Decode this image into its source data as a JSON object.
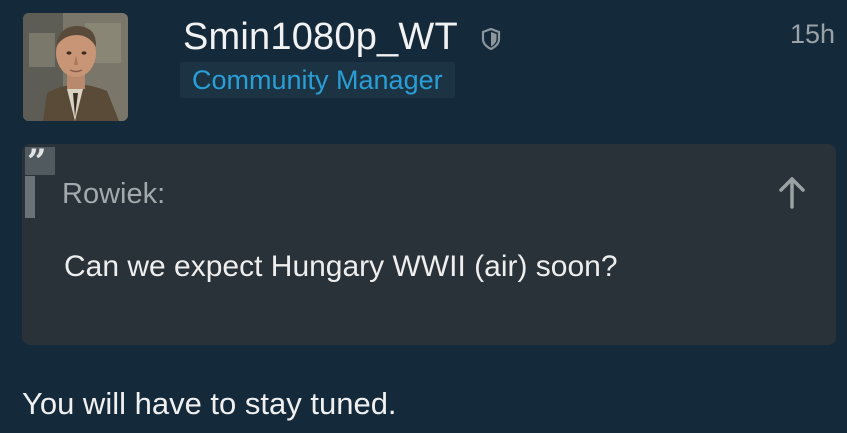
{
  "post": {
    "author": {
      "username": "Smin1080p_WT",
      "title": "Community Manager",
      "moderator_icon": "shield-icon"
    },
    "timestamp": "15h",
    "quote": {
      "author": "Rowiek:",
      "text": "Can we expect Hungary WWII (air) soon?",
      "quote_icon": "quote-mark-icon",
      "jump_icon": "arrow-up-icon"
    },
    "body": "You will have to stay tuned."
  },
  "colors": {
    "background": "#142a3a",
    "title_badge_text": "#2a9ed6",
    "quote_background": "#283238"
  }
}
